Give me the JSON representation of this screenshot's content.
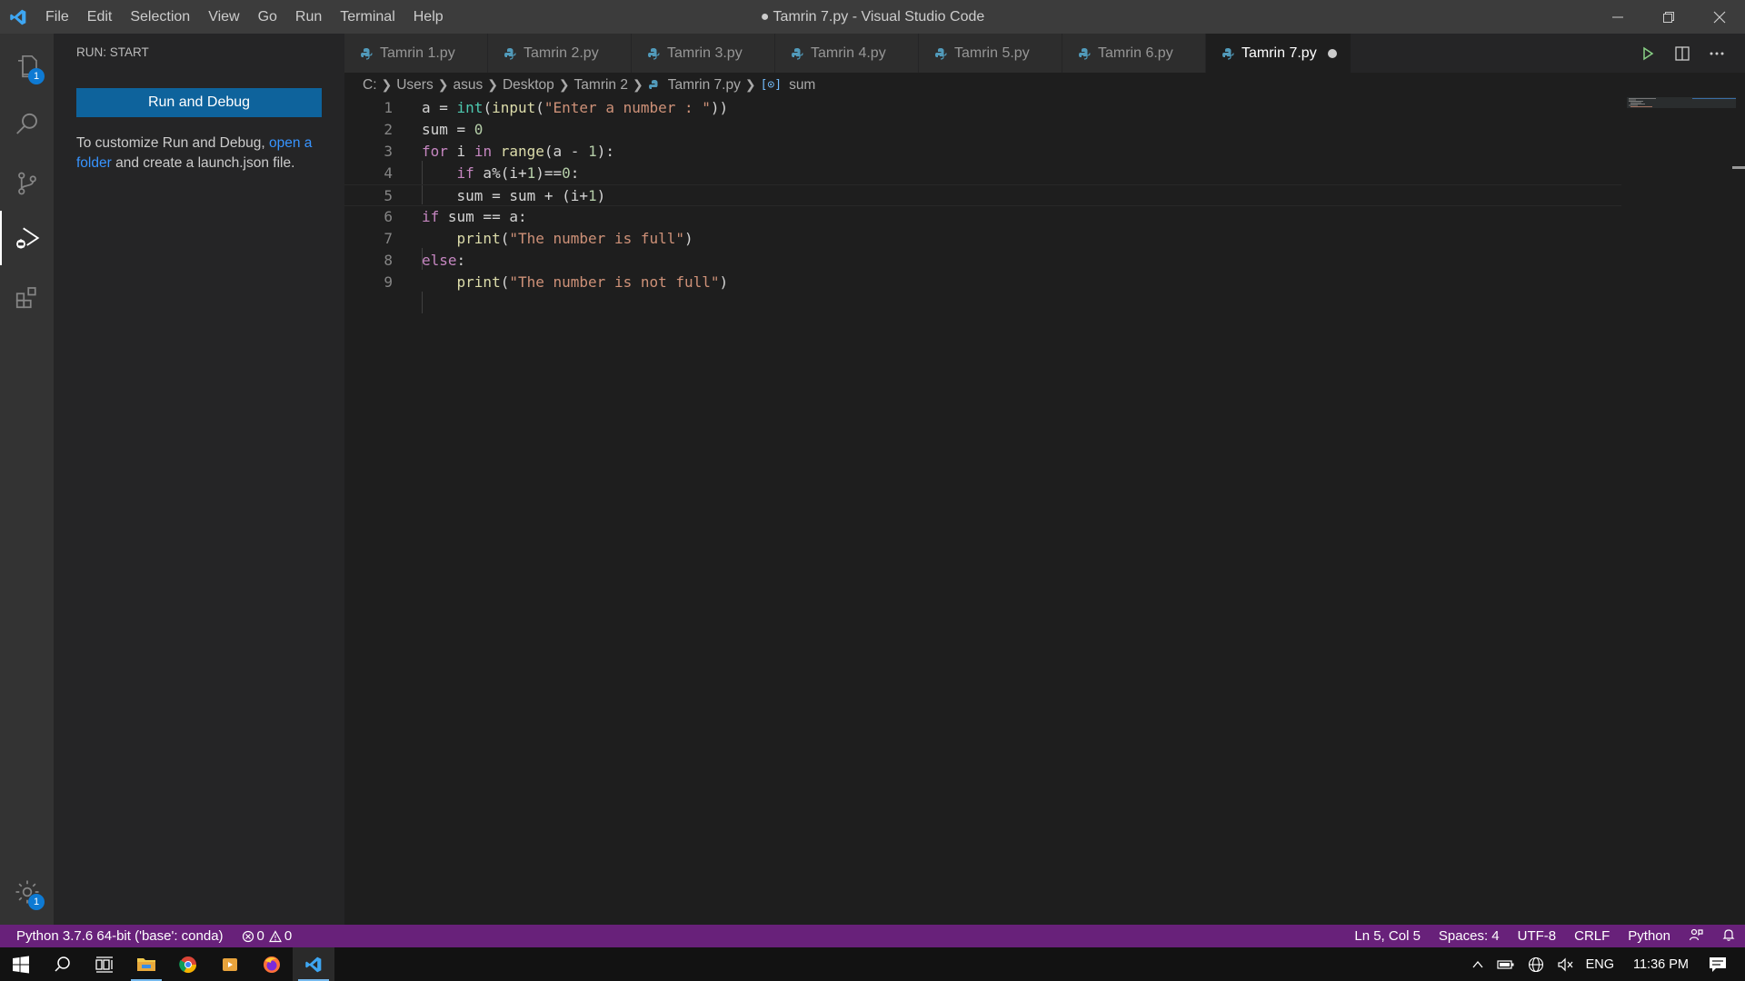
{
  "window": {
    "title": "● Tamrin 7.py - Visual Studio Code",
    "menu": [
      "File",
      "Edit",
      "Selection",
      "View",
      "Go",
      "Run",
      "Terminal",
      "Help"
    ]
  },
  "activity": {
    "explorer_badge": "1",
    "settings_badge": "1"
  },
  "sidebar": {
    "header": "RUN: START",
    "run_button": "Run and Debug",
    "desc_pre": "To customize Run and Debug, ",
    "desc_link": "open a folder",
    "desc_post": " and create a launch.json file."
  },
  "tabs": [
    {
      "label": "Tamrin 1.py"
    },
    {
      "label": "Tamrin 2.py"
    },
    {
      "label": "Tamrin 3.py"
    },
    {
      "label": "Tamrin 4.py"
    },
    {
      "label": "Tamrin 5.py"
    },
    {
      "label": "Tamrin 6.py"
    },
    {
      "label": "Tamrin 7.py"
    }
  ],
  "breadcrumb": {
    "parts": [
      "C:",
      "Users",
      "asus",
      "Desktop",
      "Tamrin 2",
      "Tamrin 7.py",
      "sum"
    ]
  },
  "editor": {
    "line_numbers": [
      "1",
      "2",
      "3",
      "4",
      "5",
      "6",
      "7",
      "8",
      "9"
    ]
  },
  "status": {
    "interpreter": "Python 3.7.6 64-bit ('base': conda)",
    "errors": "0",
    "warnings": "0",
    "position": "Ln 5, Col 5",
    "spaces": "Spaces: 4",
    "encoding": "UTF-8",
    "eol": "CRLF",
    "language": "Python"
  },
  "taskbar": {
    "language": "ENG",
    "time": "11:36 PM"
  },
  "colors": {
    "statusbar": "#68217a",
    "accent": "#0e639c"
  }
}
